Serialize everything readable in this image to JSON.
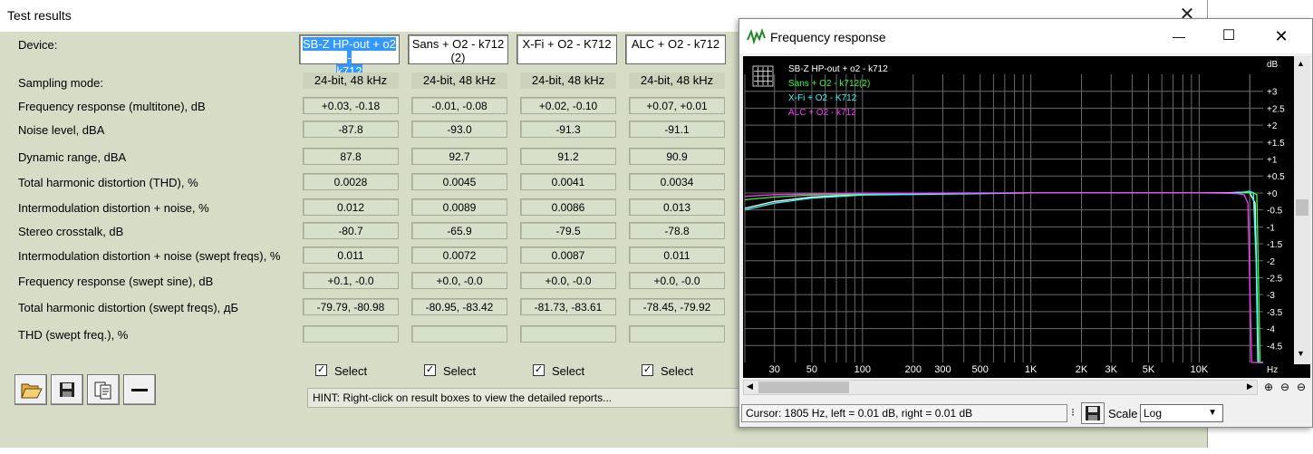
{
  "test_results": {
    "title": "Test results",
    "close_glyph": "✕",
    "row_labels": {
      "device": "Device:",
      "sampling": "Sampling mode:",
      "rows": [
        "Frequency response (multitone), dB",
        "Noise level, dBA",
        "Dynamic range, dBA",
        "Total harmonic distortion (THD), %",
        "Intermodulation distortion + noise, %",
        "Stereo crosstalk, dB",
        "Intermodulation distortion + noise (swept freqs), %",
        "Frequency response (swept sine), dB",
        "Total harmonic distortion (swept freqs), дБ",
        "THD (swept freq.), %"
      ]
    },
    "devices": [
      {
        "name_line1": "SB-Z HP-out + o2 -",
        "name_line2": "k712",
        "sampling": "24-bit, 48 kHz",
        "values": [
          "+0.03, -0.18",
          "-87.8",
          "87.8",
          "0.0028",
          "0.012",
          "-80.7",
          "0.011",
          "+0.1, -0.0",
          "-79.79, -80.98",
          ""
        ],
        "select_label": "Select",
        "checked": true
      },
      {
        "name_line1": "Sans + O2 - k712",
        "name_line2": "(2)",
        "sampling": "24-bit, 48 kHz",
        "values": [
          "-0.01, -0.08",
          "-93.0",
          "92.7",
          "0.0045",
          "0.0089",
          "-65.9",
          "0.0072",
          "+0.0, -0.0",
          "-80.95, -83.42",
          ""
        ],
        "select_label": "Select",
        "checked": true
      },
      {
        "name_line1": "X-Fi + O2 - K712",
        "name_line2": "",
        "sampling": "24-bit, 48 kHz",
        "values": [
          "+0.02, -0.10",
          "-91.3",
          "91.2",
          "0.0041",
          "0.0086",
          "-79.5",
          "0.0087",
          "+0.0, -0.0",
          "-81.73, -83.61",
          ""
        ],
        "select_label": "Select",
        "checked": true
      },
      {
        "name_line1": "ALC + O2 - k712",
        "name_line2": "",
        "sampling": "24-bit, 48 kHz",
        "values": [
          "+0.07, +0.01",
          "-91.1",
          "90.9",
          "0.0034",
          "0.013",
          "-78.8",
          "0.011",
          "+0.0, -0.0",
          "-78.45, -79.92",
          ""
        ],
        "select_label": "Select",
        "checked": true
      }
    ],
    "hint": "HINT: Right-click on result boxes to view the detailed reports...",
    "toolbar": [
      "open-folder-icon",
      "save-disk-icon",
      "copy-pages-icon",
      "minus-icon"
    ]
  },
  "freq_window": {
    "title": "Frequency response",
    "minimize_glyph": "—",
    "maximize_glyph": "☐",
    "close_glyph": "✕",
    "legend": [
      {
        "label": "SB-Z HP-out + o2 - k712",
        "color": "#ffffff"
      },
      {
        "label": "Sans + O2 - k712(2)",
        "color": "#33ff33"
      },
      {
        "label": "X-Fi + O2 - K712",
        "color": "#33ffff"
      },
      {
        "label": "ALC + O2 - k712",
        "color": "#ff33ff"
      }
    ],
    "unit_label": "dB",
    "hz_label": "Hz",
    "cursor_text": "Cursor:  1805 Hz,  left = 0.01 dB,  right = 0.01 dB",
    "scale_label": "Scale",
    "scale_value": "Log"
  },
  "chart_data": {
    "type": "line",
    "title": "Frequency response",
    "xlabel": "Hz",
    "ylabel": "dB",
    "x_scale": "log",
    "xlim": [
      20,
      24000
    ],
    "ylim": [
      -5,
      3.5
    ],
    "x_ticks": [
      {
        "value": 30,
        "label": "30"
      },
      {
        "value": 50,
        "label": "50"
      },
      {
        "value": 100,
        "label": "100"
      },
      {
        "value": 200,
        "label": "200"
      },
      {
        "value": 300,
        "label": "300"
      },
      {
        "value": 500,
        "label": "500"
      },
      {
        "value": 1000,
        "label": "1K"
      },
      {
        "value": 2000,
        "label": "2K"
      },
      {
        "value": 3000,
        "label": "3K"
      },
      {
        "value": 5000,
        "label": "5K"
      },
      {
        "value": 10000,
        "label": "10K"
      }
    ],
    "y_ticks": [
      {
        "value": 3,
        "label": "+3"
      },
      {
        "value": 2.5,
        "label": "+2.5"
      },
      {
        "value": 2,
        "label": "+2"
      },
      {
        "value": 1.5,
        "label": "+1.5"
      },
      {
        "value": 1,
        "label": "+1"
      },
      {
        "value": 0.5,
        "label": "+0.5"
      },
      {
        "value": 0,
        "label": "+0"
      },
      {
        "value": -0.5,
        "label": "-0.5"
      },
      {
        "value": -1,
        "label": "-1"
      },
      {
        "value": -1.5,
        "label": "-1.5"
      },
      {
        "value": -2,
        "label": "-2"
      },
      {
        "value": -2.5,
        "label": "-2.5"
      },
      {
        "value": -3,
        "label": "-3"
      },
      {
        "value": -3.5,
        "label": "-3.5"
      },
      {
        "value": -4,
        "label": "-4"
      },
      {
        "value": -4.5,
        "label": "-4.5"
      }
    ],
    "grid": true,
    "legend_position": "top-left",
    "series": [
      {
        "name": "SB-Z HP-out + o2 - k712",
        "color": "#ffffff",
        "x": [
          20,
          30,
          50,
          100,
          200,
          500,
          1000,
          5000,
          10000,
          15000,
          18000,
          20000,
          21500,
          22500,
          24000
        ],
        "y": [
          -0.45,
          -0.25,
          -0.12,
          -0.05,
          -0.02,
          -0.01,
          0,
          0,
          0,
          0.01,
          0.02,
          0,
          -0.3,
          -5,
          -5
        ]
      },
      {
        "name": "Sans + O2 - k712(2)",
        "color": "#33ff33",
        "x": [
          20,
          30,
          50,
          100,
          500,
          1000,
          5000,
          10000,
          15000,
          18000,
          21000,
          22000,
          23000,
          24000
        ],
        "y": [
          -0.2,
          -0.12,
          -0.06,
          -0.03,
          -0.01,
          0,
          0,
          0,
          0,
          0.01,
          0,
          -0.05,
          -5,
          -5
        ]
      },
      {
        "name": "X-Fi + O2 - K712",
        "color": "#33ffff",
        "x": [
          20,
          30,
          50,
          100,
          500,
          1000,
          5000,
          10000,
          15000,
          18000,
          20000,
          21000,
          21800,
          22300,
          24000
        ],
        "y": [
          -0.5,
          -0.3,
          -0.15,
          -0.06,
          -0.02,
          0,
          0,
          0,
          0,
          0.02,
          0.05,
          0,
          -2,
          -5,
          -5
        ]
      },
      {
        "name": "ALC + O2 - k712",
        "color": "#ff33ff",
        "x": [
          20,
          30,
          50,
          100,
          500,
          1000,
          5000,
          10000,
          15000,
          17000,
          18500,
          19500,
          20500,
          24000
        ],
        "y": [
          -0.1,
          -0.05,
          -0.03,
          -0.01,
          0,
          0,
          0,
          0,
          -0.01,
          -0.02,
          -0.05,
          -0.3,
          -5,
          -5
        ]
      }
    ]
  }
}
